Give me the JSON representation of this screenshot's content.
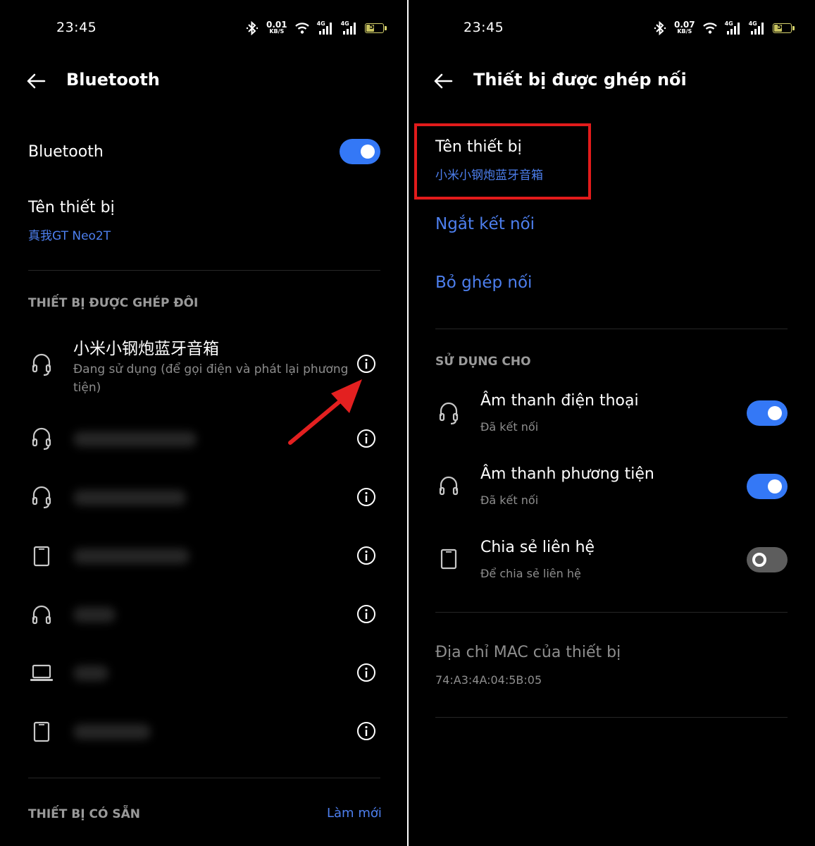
{
  "left": {
    "status": {
      "time": "23:45",
      "speed_value": "0.01",
      "speed_unit": "KB/S",
      "net1": "4G",
      "net2": "4G",
      "battery": "50"
    },
    "header": {
      "title": "Bluetooth"
    },
    "bluetooth_row": {
      "label": "Bluetooth",
      "enabled": true
    },
    "device_name": {
      "label": "Tên thiết bị",
      "value": "真我GT Neo2T"
    },
    "paired_section": "THIẾT BỊ ĐƯỢC GHÉP ĐÔI",
    "paired_devices": [
      {
        "icon": "headset-icon",
        "name": "小米小钢炮蓝牙音箱",
        "status": "Đang sử dụng (để gọi điện và phát lại phương tiện)"
      },
      {
        "icon": "headset-icon"
      },
      {
        "icon": "headset-icon"
      },
      {
        "icon": "phone-icon"
      },
      {
        "icon": "headphones-icon"
      },
      {
        "icon": "laptop-icon"
      },
      {
        "icon": "phone-icon"
      }
    ],
    "available_section": "THIẾT BỊ CÓ SẴN",
    "refresh_label": "Làm mới"
  },
  "right": {
    "status": {
      "time": "23:45",
      "speed_value": "0.07",
      "speed_unit": "KB/S",
      "net1": "4G",
      "net2": "4G",
      "battery": "50"
    },
    "header": {
      "title": "Thiết bị được ghép nối"
    },
    "device_name": {
      "label": "Tên thiết bị",
      "value": "小米小钢炮蓝牙音箱"
    },
    "disconnect_label": "Ngắt kết nối",
    "unpair_label": "Bỏ ghép nối",
    "use_for_section": "SỬ DỤNG CHO",
    "profiles": [
      {
        "icon": "headset-icon",
        "title": "Âm thanh điện thoại",
        "subtitle": "Đã kết nối",
        "enabled": true
      },
      {
        "icon": "headphones-icon",
        "title": "Âm thanh phương tiện",
        "subtitle": "Đã kết nối",
        "enabled": true
      },
      {
        "icon": "phone-icon",
        "title": "Chia sẻ liên hệ",
        "subtitle": "Để chia sẻ liên hệ",
        "enabled": false
      }
    ],
    "mac": {
      "label": "Địa chỉ MAC của thiết bị",
      "value": "74:A3:4A:04:5B:05"
    }
  },
  "colors": {
    "accent": "#4d7fee",
    "toggle_on": "#3478f6",
    "highlight": "#e21b1b",
    "arrow": "#e32020"
  }
}
